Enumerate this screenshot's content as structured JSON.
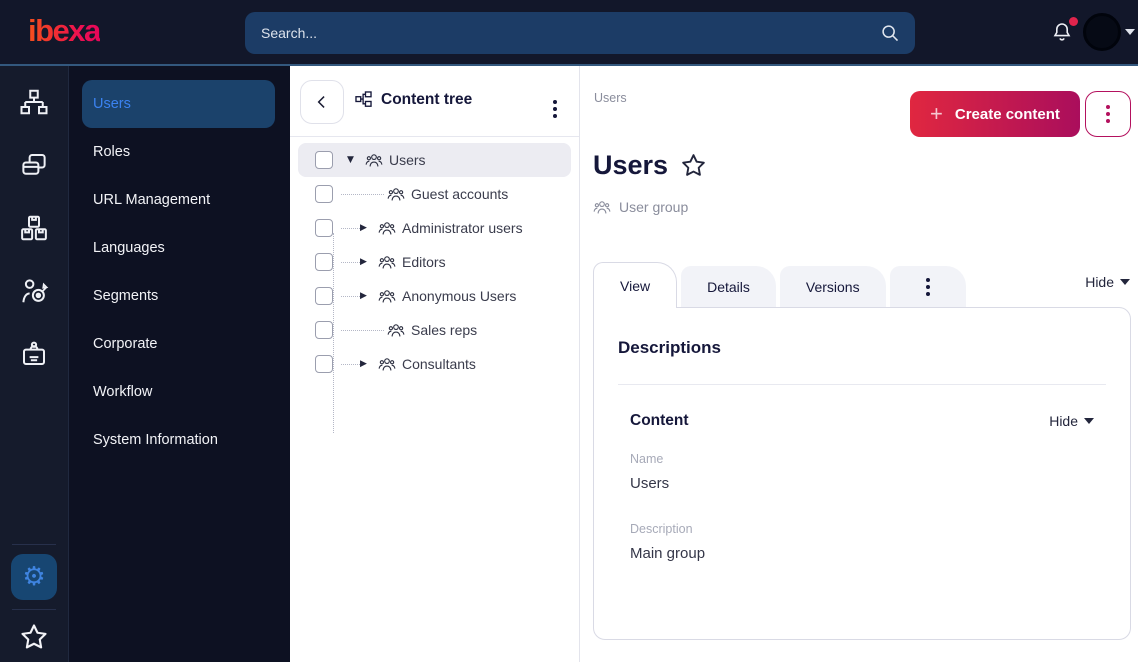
{
  "topbar": {
    "logo": "ibexa",
    "search_placeholder": "Search...",
    "icons": [
      "search-icon",
      "notification-bell-icon",
      "user-avatar",
      "caret-down"
    ]
  },
  "rail": {
    "icons": [
      "content-structure-icon",
      "pages-icon",
      "product-catalog-icon",
      "personalization-icon",
      "corporate-badge-icon",
      "settings-gear-icon",
      "bookmarks-star-icon"
    ],
    "gear_glyph": "⚙"
  },
  "sidebar": {
    "active_item": "Users",
    "items": [
      "Users",
      "Roles",
      "URL Management",
      "Languages",
      "Segments",
      "Corporate",
      "Workflow",
      "System Information"
    ]
  },
  "content_tree": {
    "title": "Content tree",
    "items": [
      {
        "label": "Users",
        "arrow": "▼",
        "selected": true,
        "root": true
      },
      {
        "label": "Guest accounts",
        "arrow": ""
      },
      {
        "label": "Administrator users",
        "arrow": "▶"
      },
      {
        "label": "Editors",
        "arrow": "▶"
      },
      {
        "label": "Anonymous Users",
        "arrow": "▶"
      },
      {
        "label": "Sales reps",
        "arrow": ""
      },
      {
        "label": "Consultants",
        "arrow": "▶"
      }
    ]
  },
  "main": {
    "breadcrumb": "Users",
    "create_button": "Create content",
    "plus_glyph": "+",
    "title": "Users",
    "content_type": "User group",
    "tabs": [
      "View",
      "Details",
      "Versions"
    ],
    "active_tab": "View",
    "hide_label": "Hide",
    "card": {
      "descriptions_title": "Descriptions",
      "content_title": "Content",
      "content_hide_label": "Hide",
      "fields": [
        {
          "label": "Name",
          "value": "Users"
        },
        {
          "label": "Description",
          "value": "Main group"
        }
      ]
    }
  },
  "colors": {
    "topbar_bg": "#12172a",
    "topbar_border": "#33587e",
    "search_bg": "#1c3c66",
    "sidebar_bg": "#0d1122",
    "rail_bg": "#151b2c",
    "active_menu_bg": "#1b426b",
    "accent_blue": "#3b82f0",
    "brand_gradient_start": "#e02740",
    "brand_gradient_end": "#aa0e5c",
    "notification_red": "#e0244c",
    "selected_tree_row": "#ececf2",
    "heading_text": "#15173a"
  }
}
